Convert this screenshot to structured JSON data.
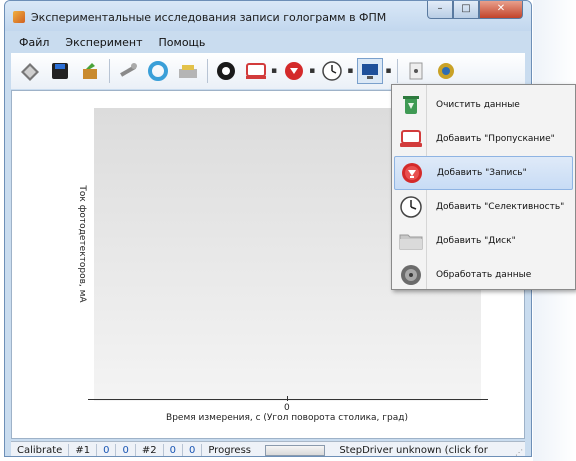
{
  "window": {
    "title": "Экспериментальные исследования записи голограмм в ФПМ"
  },
  "menu": {
    "items": [
      {
        "label": "Файл"
      },
      {
        "label": "Эксперимент"
      },
      {
        "label": "Помощь"
      }
    ]
  },
  "toolbar": {
    "icons": [
      "open-file-icon",
      "save-disk-icon",
      "package-icon",
      "tools-icon",
      "ring-icon",
      "scanner-icon",
      "gear-icon",
      "transmission-icon",
      "record-icon",
      "clock-icon",
      "monitor-icon",
      "document-icon",
      "network-icon"
    ]
  },
  "plot": {
    "xlabel": "Время измерения, с (Угол поворота столика, град)",
    "ylabel": "Ток фотодетекторов, мА",
    "x_tick_zero": "0"
  },
  "dropdown": {
    "items": [
      {
        "label": "Очистить данные",
        "icon": "trash-icon"
      },
      {
        "label": "Добавить \"Пропускание\"",
        "icon": "transmission-icon"
      },
      {
        "label": "Добавить \"Запись\"",
        "icon": "record-icon",
        "highlighted": true
      },
      {
        "label": "Добавить \"Селективность\"",
        "icon": "clock-icon"
      },
      {
        "label": "Добавить \"Диск\"",
        "icon": "folder-icon"
      },
      {
        "label": "Обработать данные",
        "icon": "process-icon"
      }
    ]
  },
  "status": {
    "calibrate": "Calibrate",
    "ch1_label": "#1",
    "ch1_val_a": "0",
    "ch1_val_b": "0",
    "ch2_label": "#2",
    "ch2_val_a": "0",
    "ch2_val_b": "0",
    "progress_label": "Progress",
    "progress_fraction": 0,
    "stepdriver": "StepDriver unknown (click for check)"
  },
  "colors": {
    "accent": "#1a56b4",
    "close_button": "#c2432a",
    "highlight": "#c8dcf5"
  }
}
